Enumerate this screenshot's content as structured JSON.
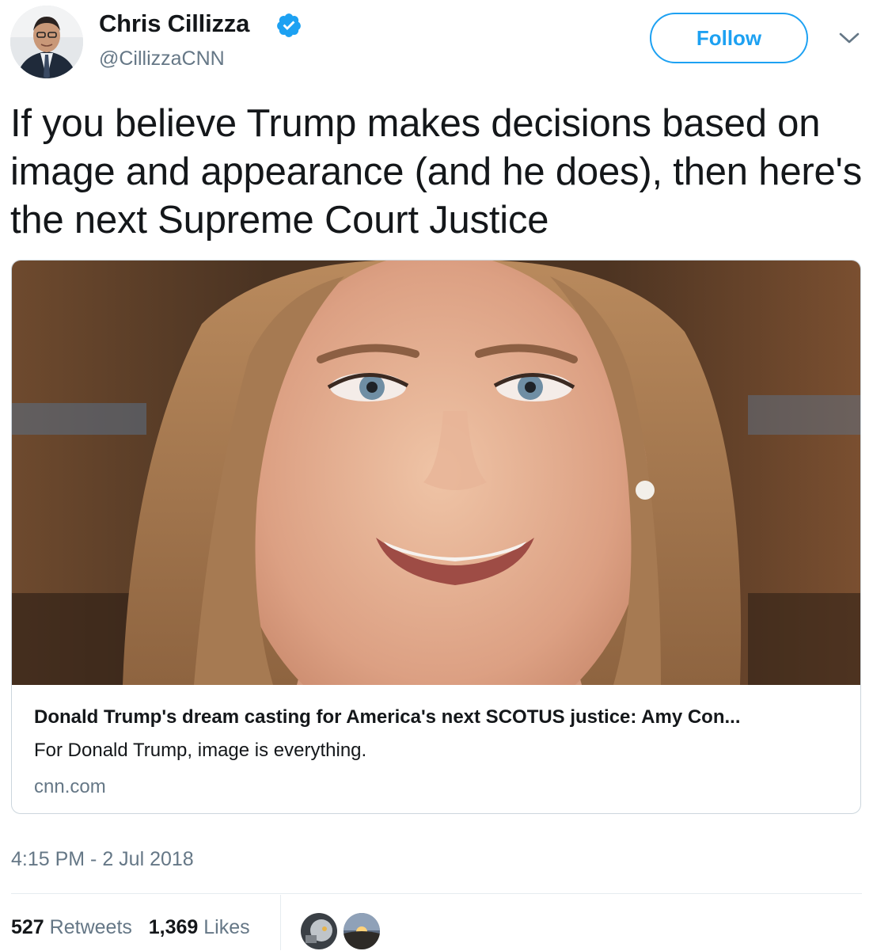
{
  "author": {
    "display_name": "Chris Cillizza",
    "handle": "@CillizzaCNN",
    "verified": true
  },
  "actions": {
    "follow_label": "Follow"
  },
  "tweet": {
    "text": "If you believe Trump makes decisions based on image and appearance (and he does), then here's the next Supreme Court Justice",
    "timestamp": "4:15 PM - 2 Jul 2018"
  },
  "card": {
    "title": "Donald Trump's dream casting for America's next SCOTUS justice: Amy Con...",
    "description": "For Donald Trump, image is everything.",
    "domain": "cnn.com"
  },
  "stats": {
    "retweets_count": "527",
    "retweets_label": "Retweets",
    "likes_count": "1,369",
    "likes_label": "Likes"
  },
  "colors": {
    "accent": "#1da1f2",
    "secondary_text": "#657786",
    "primary_text": "#14171a",
    "border": "#ccd6dd"
  },
  "icons": [
    "verified-badge-icon",
    "chevron-down-icon"
  ]
}
